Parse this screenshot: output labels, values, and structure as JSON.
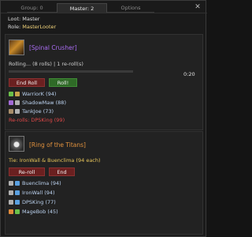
{
  "tabs": [
    {
      "label": "Group: 0"
    },
    {
      "label": "Master: 2"
    },
    {
      "label": "Options"
    }
  ],
  "header": {
    "loot_label": "Loot:",
    "loot_value": "Master",
    "role_label": "Role:",
    "role_value": "MasterLooter"
  },
  "items": [
    {
      "name": "[Spinal Crusher]",
      "status": "Rolling... (8 rolls) | 1 re-roll(s)",
      "timer": "0:20",
      "buttons": [
        "End Roll",
        "Roll!"
      ],
      "candidates": [
        {
          "name": "WarriorK",
          "score": "(94)"
        },
        {
          "name": "ShadowMaw",
          "score": "(88)"
        },
        {
          "name": "TankJoe",
          "score": "(73)"
        }
      ],
      "rerolls": "Re-rolls: DPSKing (99)"
    },
    {
      "name": "[Ring of the Titans]",
      "tie": "Tie: IronWall & Buenclima (94 each)",
      "buttons": [
        "Re-roll",
        "End"
      ],
      "candidates": [
        {
          "name": "Buenclima",
          "score": "(94)"
        },
        {
          "name": "IronWall",
          "score": "(94)"
        },
        {
          "name": "DPSKing",
          "score": "(77)"
        },
        {
          "name": "MageBob",
          "score": "(45)"
        }
      ]
    }
  ],
  "colors": {
    "epic": "#a86cf0",
    "rare": "#e0913d",
    "reroll_red": "#e04848",
    "tie_gold": "#e7c55a",
    "button_red": "#6a2020",
    "button_green": "#2f6a27"
  },
  "icons": {
    "close": "close-icon",
    "item1": "mace-icon",
    "item2": "ring-icon"
  }
}
